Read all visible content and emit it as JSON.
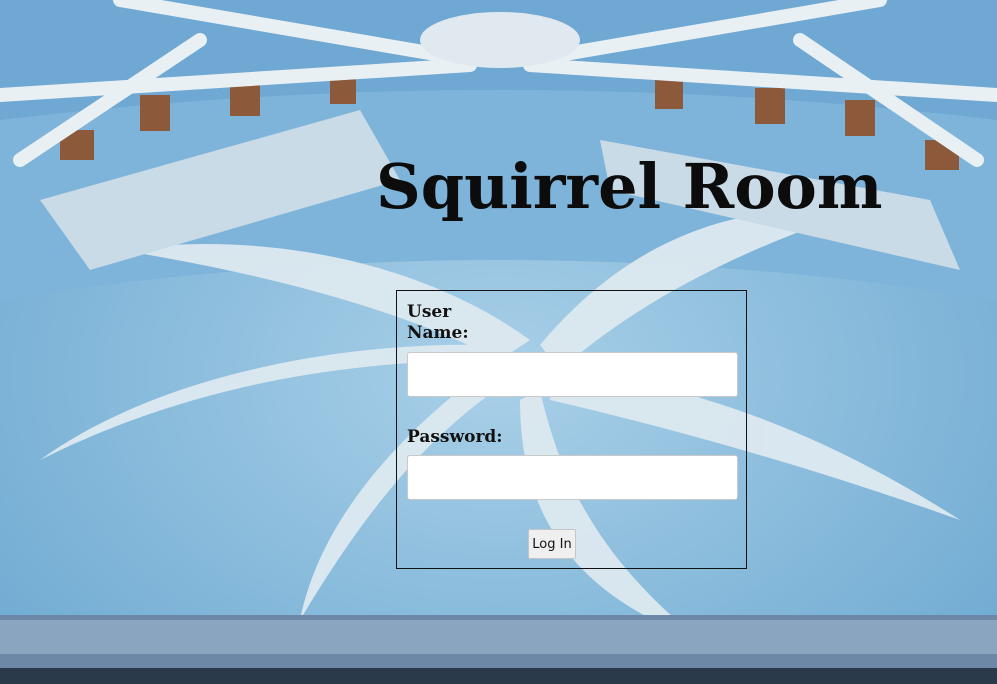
{
  "page": {
    "title": "Squirrel Room"
  },
  "login_form": {
    "username_label": "User Name:",
    "password_label": "Password:",
    "username_value": "",
    "password_value": "",
    "login_button": "Log In"
  },
  "background": {
    "subject": "squirrel room photograph",
    "colors": {
      "floor_blue": "#8fbedc",
      "swirl_white": "#dde9f0",
      "wall_blue": "#5f9dc8"
    }
  }
}
